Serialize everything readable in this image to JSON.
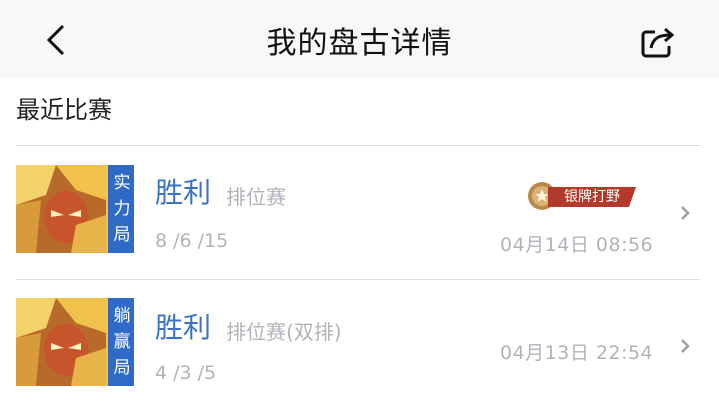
{
  "header": {
    "title": "我的盘古详情",
    "back_icon": "chevron-left-icon",
    "share_icon": "share-icon"
  },
  "section": {
    "title": "最近比赛"
  },
  "badge": {
    "label": "银牌打野",
    "icon": "medal-icon"
  },
  "matches": [
    {
      "mode_tag": [
        "实",
        "力",
        "局"
      ],
      "result": "胜利",
      "mode": "排位赛",
      "kda": "8 /6 /15",
      "datetime": "04月14日 08:56"
    },
    {
      "mode_tag": [
        "躺",
        "赢",
        "局"
      ],
      "result": "胜利",
      "mode": "排位赛(双排)",
      "kda": "4 /3 /5",
      "datetime": "04月13日 22:54"
    }
  ],
  "colors": {
    "accent_blue": "#3b72c4",
    "tag_blue": "#2f6ac7",
    "muted_text": "#b0b4ba",
    "badge_red": "#b33a2a"
  }
}
